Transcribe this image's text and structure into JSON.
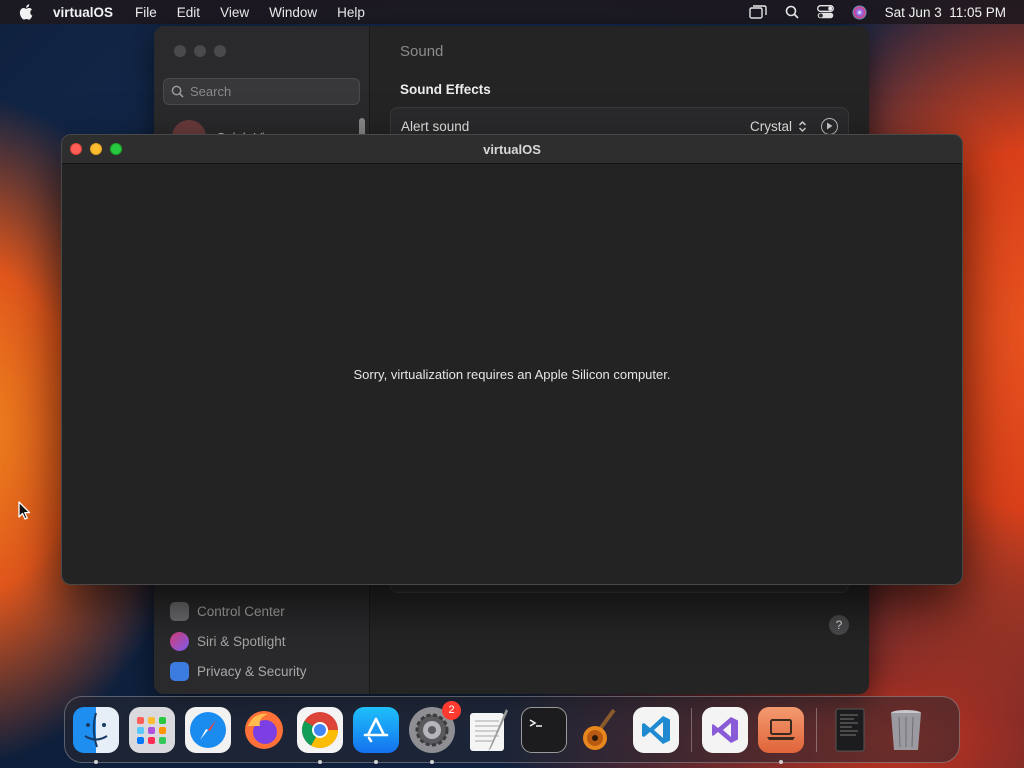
{
  "menubar": {
    "app_name": "virtualOS",
    "menus": [
      "File",
      "Edit",
      "View",
      "Window",
      "Help"
    ],
    "clock": "Sat Jun 3  11:05 PM",
    "status_icons": [
      "screen-mirroring-icon",
      "spotlight-search-icon",
      "control-center-icon",
      "siri-icon"
    ]
  },
  "settings": {
    "title": "Sound",
    "search_placeholder": "Search",
    "user_name": "Caluh Viem",
    "section_title": "Sound Effects",
    "alert_label": "Alert sound",
    "alert_value": "Crystal",
    "sidebar_items": [
      {
        "label": "Control Center",
        "color": "#6e6e70"
      },
      {
        "label": "Siri & Spotlight",
        "color": "#b0397f"
      },
      {
        "label": "Privacy & Security",
        "color": "#3c7be0"
      }
    ],
    "help_label": "?"
  },
  "vm_window": {
    "title": "virtualOS",
    "message": "Sorry, virtualization requires an Apple Silicon computer."
  },
  "dock": {
    "items": [
      {
        "name": "finder",
        "running": true
      },
      {
        "name": "launchpad",
        "running": false
      },
      {
        "name": "safari",
        "running": false
      },
      {
        "name": "firefox",
        "running": false
      },
      {
        "name": "chrome",
        "running": true
      },
      {
        "name": "app-store",
        "running": true
      },
      {
        "name": "system-settings",
        "running": true,
        "badge": "2"
      },
      {
        "name": "textedit",
        "running": false
      },
      {
        "name": "terminal",
        "running": false
      },
      {
        "name": "garageband",
        "running": false
      },
      {
        "name": "vscode",
        "running": false
      },
      {
        "name": "visual-studio",
        "running": false
      },
      {
        "name": "virtualos",
        "running": true
      },
      {
        "name": "downloads-stack",
        "running": false
      },
      {
        "name": "trash",
        "running": false
      }
    ]
  }
}
